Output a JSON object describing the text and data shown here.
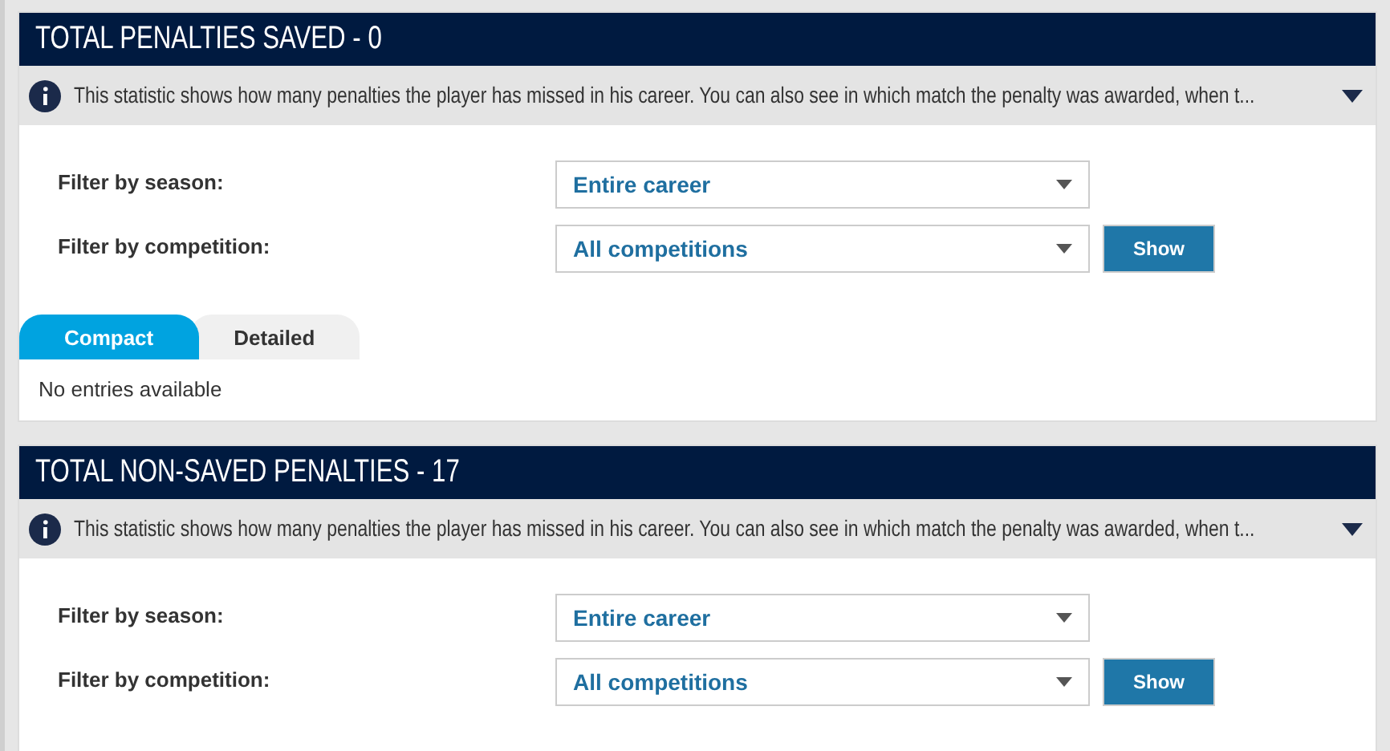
{
  "sections": [
    {
      "title": "TOTAL PENALTIES SAVED - 0",
      "info": "This statistic shows how many penalties the player has missed in his career. You can also see in which match the penalty was awarded, when t...",
      "filters": [
        {
          "label": "Filter by season:",
          "value": "Entire career"
        },
        {
          "label": "Filter by competition:",
          "value": "All competitions"
        }
      ],
      "button": "Show",
      "tabs": [
        {
          "label": "Compact",
          "selected": true
        },
        {
          "label": "Detailed",
          "selected": false
        }
      ],
      "empty": "No entries available"
    },
    {
      "title": "TOTAL NON-SAVED PENALTIES - 17",
      "info": "This statistic shows how many penalties the player has missed in his career. You can also see in which match the penalty was awarded, when t...",
      "filters": [
        {
          "label": "Filter by season:",
          "value": "Entire career"
        },
        {
          "label": "Filter by competition:",
          "value": "All competitions"
        }
      ],
      "button": "Show"
    }
  ]
}
